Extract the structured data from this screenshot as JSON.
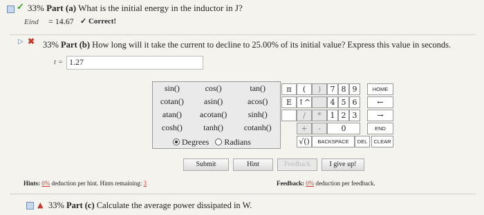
{
  "part_a": {
    "percent": "33%",
    "title": "Part (a)",
    "question": "What is the initial energy in the inductor in J?",
    "answer_label": "Eind",
    "answer_equals": "=",
    "answer_value": "14.67",
    "status": "✓ Correct!"
  },
  "part_b": {
    "percent": "33%",
    "title": "Part (b)",
    "question": "How long will it take the current to decline to 25.00% of its initial value? Express this value in seconds.",
    "answer_label": "t =",
    "answer_value": "1.27"
  },
  "calculator": {
    "functions": [
      [
        "sin()",
        "cos()",
        "tan()"
      ],
      [
        "cotan()",
        "asin()",
        "acos()"
      ],
      [
        "atan()",
        "acotan()",
        "sinh()"
      ],
      [
        "cosh()",
        "tanh()",
        "cotanh()"
      ]
    ],
    "degrees_label": "Degrees",
    "radians_label": "Radians",
    "mode_selected": "Degrees",
    "keys": {
      "pi": "π",
      "lparen": "(",
      "rparen": ")",
      "e": "E",
      "pow": "↑^",
      "sqrtpow": "",
      "div": "/",
      "mul": "*",
      "plus": "+",
      "minus": "-",
      "sqrt": "√()",
      "backspace": "BACKSPACE",
      "del": "DEL",
      "clear": "CLEAR",
      "n7": "7",
      "n8": "8",
      "n9": "9",
      "n4": "4",
      "n5": "5",
      "n6": "6",
      "n1": "1",
      "n2": "2",
      "n3": "3",
      "n0": "0",
      "home": "HOME",
      "left": "←",
      "right": "→",
      "end": "END"
    }
  },
  "buttons": {
    "submit": "Submit",
    "hint": "Hint",
    "feedback": "Feedback",
    "give_up": "I give up!"
  },
  "hints": {
    "label": "Hints:",
    "pct": "0%",
    "text": "deduction per hint. Hints remaining:",
    "remaining": "3"
  },
  "feedback": {
    "label": "Feedback:",
    "pct": "0%",
    "text": "deduction per feedback."
  },
  "part_c": {
    "percent": "33%",
    "title": "Part (c)",
    "question": "Calculate the average power dissipated in W."
  }
}
